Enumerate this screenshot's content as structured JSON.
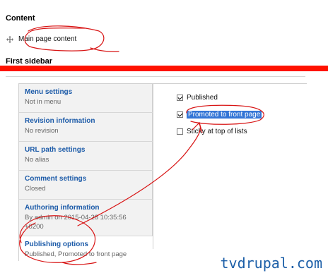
{
  "regions": {
    "content": {
      "title": "Content",
      "block_label": "Main page content"
    },
    "first_sidebar": {
      "title": "First sidebar"
    }
  },
  "vertical_tabs": [
    {
      "title": "Menu settings",
      "summary": "Not in menu"
    },
    {
      "title": "Revision information",
      "summary": "No revision"
    },
    {
      "title": "URL path settings",
      "summary": "No alias"
    },
    {
      "title": "Comment settings",
      "summary": "Closed"
    },
    {
      "title": "Authoring information",
      "summary_line1": "By admin on 2015-04-28 10:35:56",
      "summary_line2": "+0200"
    },
    {
      "title": "Publishing options",
      "summary": "Published, Promoted to front page"
    }
  ],
  "publishing_options": {
    "published": {
      "label": "Published",
      "checked": true
    },
    "promoted": {
      "label": "Promoted to front page",
      "checked": true
    },
    "sticky": {
      "label": "Sticky at top of lists",
      "checked": false
    }
  },
  "annotation_color": "#d81414",
  "highlight_color": "#ff1200",
  "watermark": "tvdrupal.com"
}
